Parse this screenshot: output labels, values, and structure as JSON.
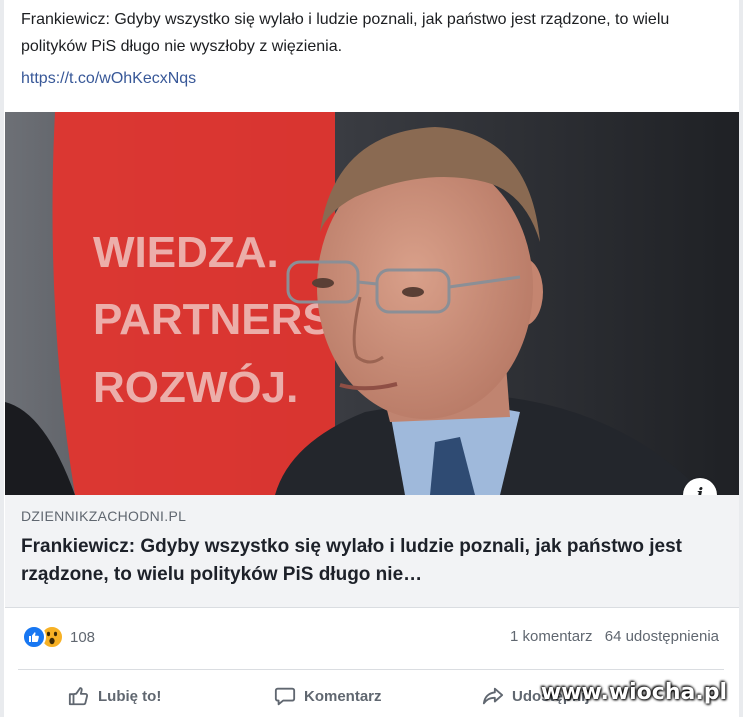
{
  "post": {
    "text": "Frankiewicz: Gdyby wszystko się wylało i ludzie poznali, jak państwo jest rządzone, to wielu polityków PiS długo nie wyszłoby z więzienia.",
    "link": "https://t.co/wOhKecxNqs"
  },
  "photo": {
    "banner_lines": [
      "WIEDZA.",
      "PARTNERST",
      "ROZWÓJ."
    ],
    "info_icon": "info-icon"
  },
  "preview": {
    "domain": "DZIENNIKZACHODNI.PL",
    "headline": "Frankiewicz: Gdyby wszystko się wylało i ludzie poznali, jak państwo jest rządzone, to wielu polityków PiS długo nie…"
  },
  "stats": {
    "reaction_icons": [
      "like-icon",
      "wow-icon"
    ],
    "reaction_count": "108",
    "comments": "1 komentarz",
    "shares": "64 udostępnienia"
  },
  "actions": {
    "like": "Lubię to!",
    "comment": "Komentarz",
    "share": "Udostępnij"
  },
  "watermark": "www.wiocha.pl",
  "colors": {
    "link": "#385898",
    "like_blue": "#1877f2",
    "wow_yellow": "#f7b125",
    "banner_red": "#e1352f"
  }
}
